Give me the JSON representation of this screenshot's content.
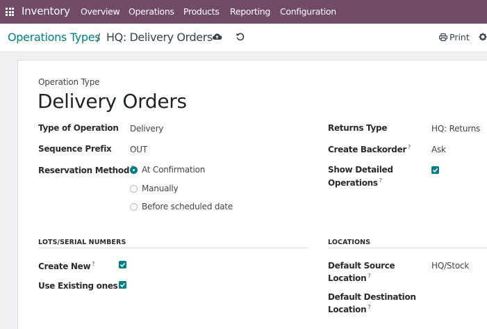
{
  "navbar": {
    "app_name": "Inventory",
    "menu": [
      "Overview",
      "Operations",
      "Products",
      "Reporting",
      "Configuration"
    ]
  },
  "breadcrumb": {
    "parent": "Operations Types",
    "separator": "/",
    "current": "HQ: Delivery Orders"
  },
  "toolbar": {
    "print_label": "Print"
  },
  "form": {
    "overline": "Operation Type",
    "title": "Delivery Orders",
    "fields_left": {
      "type_label": "Type of Operation",
      "type_value": "Delivery",
      "prefix_label": "Sequence Prefix",
      "prefix_value": "OUT",
      "reservation_label": "Reservation Method",
      "reservation_options": [
        "At Confirmation",
        "Manually",
        "Before scheduled date"
      ],
      "reservation_selected": "At Confirmation"
    },
    "fields_right": {
      "returns_label": "Returns Type",
      "returns_value": "HQ: Returns",
      "backorder_label": "Create Backorder",
      "backorder_value": "Ask",
      "detailed_label_1": "Show Detailed",
      "detailed_label_2": "Operations",
      "detailed_checked": true
    },
    "lots": {
      "title": "LOTS/SERIAL NUMBERS",
      "create_new_label": "Create New",
      "create_new_checked": true,
      "use_existing_label": "Use Existing ones",
      "use_existing_checked": true
    },
    "locations": {
      "title": "LOCATIONS",
      "source_label_1": "Default Source",
      "source_label_2": "Location",
      "source_value": "HQ/Stock",
      "dest_label_1": "Default Destination",
      "dest_label_2": "Location"
    },
    "help_mark": "?"
  },
  "colors": {
    "navbar": "#714b67",
    "accent": "#017e84"
  }
}
